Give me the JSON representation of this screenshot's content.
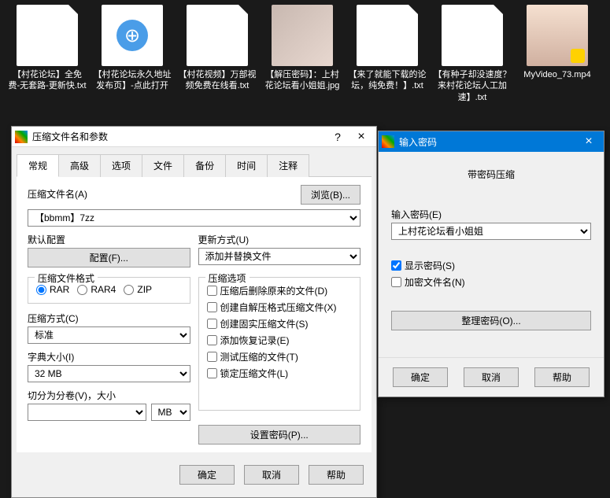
{
  "desktop": {
    "files": [
      {
        "name": "【村花论坛】全免费-无套路-更新快.txt",
        "kind": "doc"
      },
      {
        "name": "【村花论坛永久地址发布页】-点此打开",
        "kind": "html"
      },
      {
        "name": "【村花视频】万部视频免费在线看.txt",
        "kind": "doc"
      },
      {
        "name": "【解压密码】：上村花论坛看小姐姐.jpg",
        "kind": "img"
      },
      {
        "name": "【来了就能下载的论坛，纯免费！】.txt",
        "kind": "doc"
      },
      {
        "name": "【有种子却没速度？来村花论坛人工加速】.txt",
        "kind": "doc"
      },
      {
        "name": "MyVideo_73.mp4",
        "kind": "video"
      }
    ]
  },
  "mainDialog": {
    "title": "压缩文件名和参数",
    "tabs": [
      "常规",
      "高级",
      "选项",
      "文件",
      "备份",
      "时间",
      "注释"
    ],
    "archiveNameLabel": "压缩文件名(A)",
    "browseBtn": "浏览(B)...",
    "archiveName": "【bbmm】7zz",
    "defaultProfileLabel": "默认配置",
    "profilesBtn": "配置(F)...",
    "updateModeLabel": "更新方式(U)",
    "updateMode": "添加并替换文件",
    "formatLabel": "压缩文件格式",
    "formats": [
      "RAR",
      "RAR4",
      "ZIP"
    ],
    "optionsLabel": "压缩选项",
    "options": [
      "压缩后删除原来的文件(D)",
      "创建自解压格式压缩文件(X)",
      "创建固实压缩文件(S)",
      "添加恢复记录(E)",
      "测试压缩的文件(T)",
      "锁定压缩文件(L)"
    ],
    "methodLabel": "压缩方式(C)",
    "method": "标准",
    "dictLabel": "字典大小(I)",
    "dict": "32 MB",
    "splitLabel": "切分为分卷(V)，大小",
    "splitUnit": "MB",
    "setPwdBtn": "设置密码(P)...",
    "ok": "确定",
    "cancel": "取消",
    "help": "帮助"
  },
  "pwdDialog": {
    "title": "输入密码",
    "heading": "带密码压缩",
    "enterPwdLabel": "输入密码(E)",
    "password": "上村花论坛看小姐姐",
    "showPwd": "显示密码(S)",
    "encryptNames": "加密文件名(N)",
    "organizeBtn": "整理密码(O)...",
    "ok": "确定",
    "cancel": "取消",
    "help": "帮助"
  }
}
